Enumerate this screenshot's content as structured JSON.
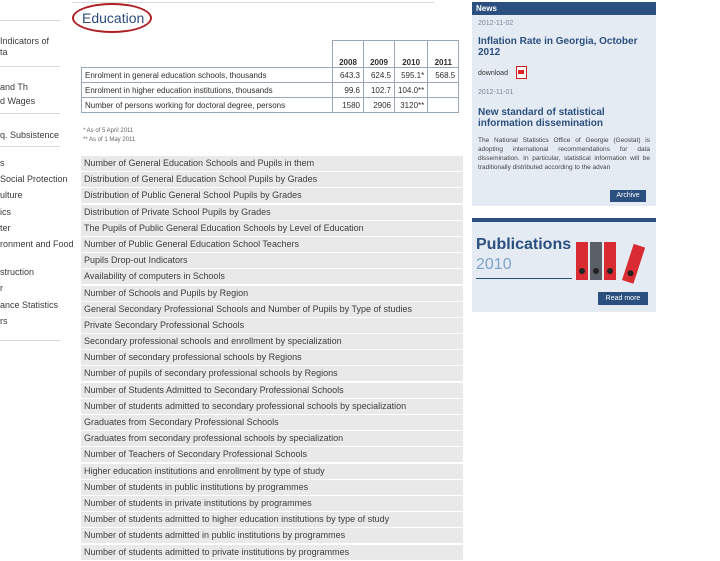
{
  "sidebar": {
    "items": [
      "Indicators of",
      "ta",
      "and Th",
      "d Wages",
      "q. Subsistence",
      "s",
      "Social Protection",
      "ulture",
      "ics",
      "ter",
      "ronment and Food",
      "struction",
      "r",
      "ance Statistics",
      "rs"
    ]
  },
  "page": {
    "title": "Education"
  },
  "stats_table": {
    "years": [
      "2008",
      "2009",
      "2010",
      "2011"
    ],
    "rows": [
      {
        "label": "Enrolment in general education schools, thousands",
        "values": [
          "643.3",
          "624.5",
          "595.1*",
          "568.5"
        ]
      },
      {
        "label": "Enrolment in higher education institutions, thousands",
        "values": [
          "99.6",
          "102.7",
          "104.0**",
          ""
        ]
      },
      {
        "label": "Number of persons working for doctoral degree, persons",
        "values": [
          "1580",
          "2906",
          "3120**",
          ""
        ]
      }
    ],
    "footnotes": [
      "* As of 5 April 2011",
      "** As of 1 May 2011"
    ]
  },
  "links": [
    "Number of General Education Schools and Pupils in them",
    "Distribution of General Education School Pupils by Grades",
    "Distribution of Public General School Pupils by Grades",
    "Distribution of Private School Pupils by Grades",
    "The Pupils of Public General Education Schools by Level of Education",
    "Number of Public General Education School Teachers",
    "Pupils Drop-out Indicators",
    "Availability of computers in Schools",
    "Number of Schools and Pupils by Region",
    "General Secondary Professional Schools and Number of Pupils by Type of studies",
    "Private Secondary Professional Schools",
    "Secondary professional schools and enrollment by specialization",
    "Number of secondary professional schools by Regions",
    "Number of pupils of secondary professional schools by Regions",
    "Number of Students Admitted to Secondary Professional Schools",
    "Number of students admitted to secondary professional schools by specialization",
    "Graduates from Secondary Professional Schools",
    "Graduates from secondary professional schools by specialization",
    "Number of Teachers of Secondary Professional Schools",
    "Higher education institutions and enrollment by type of study",
    "Number of students in public institutions by programmes",
    "Number of students in private institutions by programmes",
    "Number of students admitted to higher education institutions by type of study",
    "Number of students admitted in public institutions by programmes",
    "Number of students admitted to private institutions by programmes"
  ],
  "news": {
    "header": "News",
    "items": [
      {
        "date": "2012-11-02",
        "title": "Inflation Rate in Georgia, October 2012",
        "download_label": "download"
      },
      {
        "date": "2012-11-01",
        "title": "New standard of statistical information dissemination",
        "body": "The National Statistics Office of Georgie (Geostat) is adopting international recommendations for data dissemination. In particular, statistical information will be traditionally distributed according to the advan"
      }
    ],
    "archive_label": "Archive"
  },
  "publications": {
    "title": "Publications",
    "year": "2010",
    "read_more_label": "Read more"
  },
  "colors": {
    "brand": "#2b4f7f",
    "highlight": "#b01f24",
    "row_bg": "#e9e9e9"
  }
}
